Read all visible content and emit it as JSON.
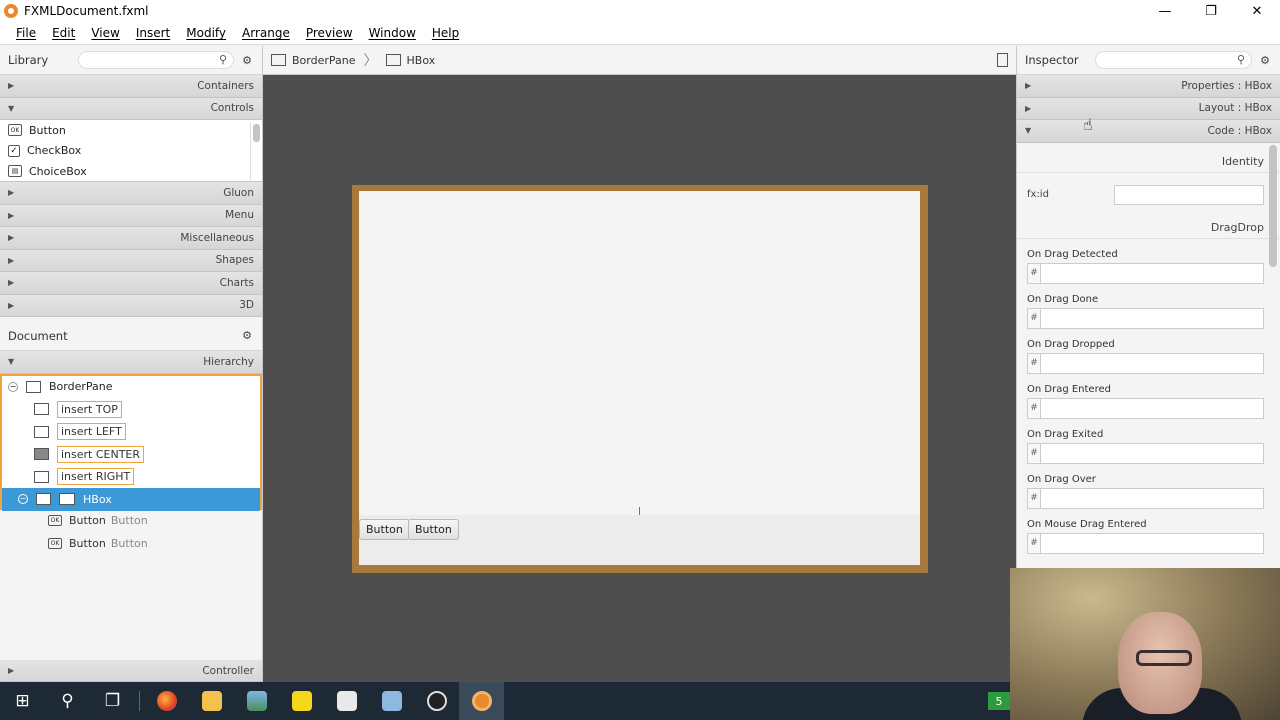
{
  "window": {
    "title": "FXMLDocument.fxml",
    "controls": [
      "—",
      "❐",
      "✕"
    ]
  },
  "menubar": [
    "File",
    "Edit",
    "View",
    "Insert",
    "Modify",
    "Arrange",
    "Preview",
    "Window",
    "Help"
  ],
  "library": {
    "title": "Library",
    "sections_top": [
      "Containers",
      "Controls"
    ],
    "controls_items": [
      {
        "label": "Button",
        "icon": "button-icon"
      },
      {
        "label": "CheckBox",
        "icon": "checkbox-icon"
      },
      {
        "label": "ChoiceBox",
        "icon": "choicebox-icon"
      }
    ],
    "sections_bottom": [
      "Gluon",
      "Menu",
      "Miscellaneous",
      "Shapes",
      "Charts",
      "3D"
    ]
  },
  "document": {
    "title": "Document",
    "hierarchy_label": "Hierarchy",
    "root": "BorderPane",
    "inserts": [
      "insert TOP",
      "insert LEFT",
      "insert CENTER",
      "insert RIGHT"
    ],
    "selected": "HBox",
    "children": [
      {
        "type": "Button",
        "text": "Button"
      },
      {
        "type": "Button",
        "text": "Button"
      }
    ],
    "controller_label": "Controller"
  },
  "breadcrumb": [
    "BorderPane",
    "HBox"
  ],
  "canvas": {
    "buttons": [
      "Button",
      "Button"
    ]
  },
  "inspector": {
    "title": "Inspector",
    "sections": [
      {
        "label": "Properties : HBox",
        "expanded": false
      },
      {
        "label": "Layout : HBox",
        "expanded": false
      },
      {
        "label": "Code : HBox",
        "expanded": true
      }
    ],
    "identity_label": "Identity",
    "fxid_label": "fx:id",
    "fxid_value": "",
    "dragdrop_label": "DragDrop",
    "events": [
      "On Drag Detected",
      "On Drag Done",
      "On Drag Dropped",
      "On Drag Entered",
      "On Drag Exited",
      "On Drag Over",
      "On Mouse Drag Entered"
    ],
    "hash": "#"
  },
  "taskbar": {
    "badge": "5"
  },
  "colors": {
    "accent_orange": "#f0a340",
    "selection_blue": "#3d98d8",
    "stage_border": "#a9783b",
    "canvas_bg": "#4e4e4e",
    "taskbar_bg": "#1d2a36"
  }
}
